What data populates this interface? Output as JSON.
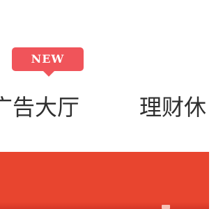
{
  "nav": {
    "badge": "NEW",
    "items": [
      {
        "label": "广告大厅"
      },
      {
        "label": "理财休"
      }
    ]
  },
  "colors": {
    "badge_bg": "#f0545a",
    "banner_bg": "#e8452f",
    "nav_text": "#2f2f2f"
  }
}
